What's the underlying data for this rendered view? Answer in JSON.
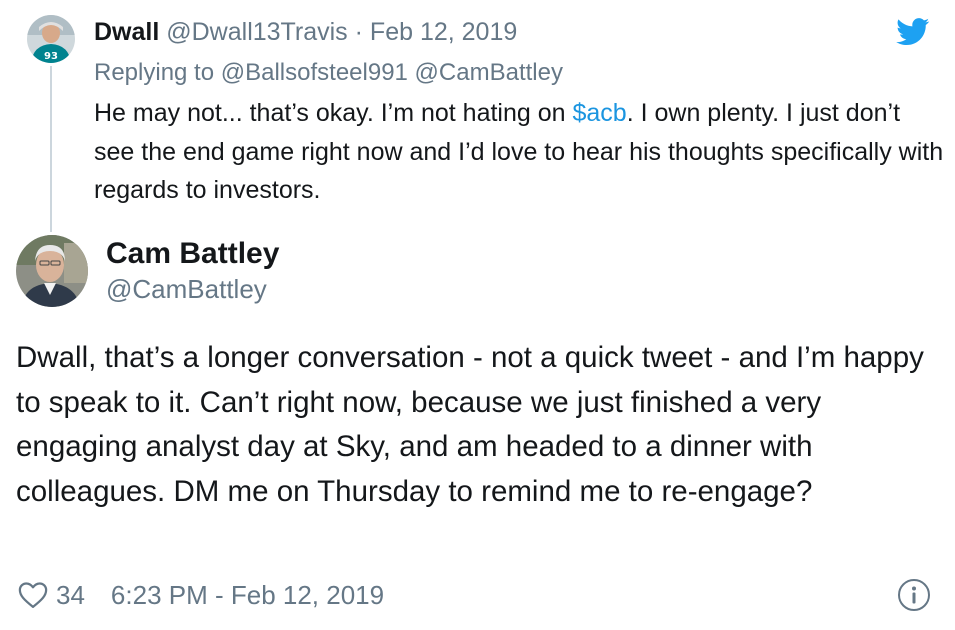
{
  "reply_tweet": {
    "author_name": "Dwall",
    "author_handle": "@Dwall13Travis",
    "separator": "·",
    "date": "Feb 12, 2019",
    "avatar_icon": "avatar-dwall-icon",
    "replying_prefix": "Replying to ",
    "replying_to": "@Ballsofsteel991 @CamBattley",
    "text_before_cashtag": "He may not... that’s okay. I’m not hating on ",
    "cashtag": "$acb",
    "text_after_cashtag": ". I own plenty. I just don’t see the end game right now and I’d love to hear his thoughts specifically with regards to investors."
  },
  "main_tweet": {
    "author_name": "Cam Battley",
    "author_handle": "@CamBattley",
    "avatar_icon": "avatar-cam-battley-icon",
    "text": "Dwall, that’s a longer conversation - not a quick tweet - and I’m happy to speak to it. Can’t right now, because we just finished a very engaging analyst day at Sky, and am headed to a dinner with colleagues. DM me on Thursday to remind me to re-engage?",
    "like_count": "34",
    "timestamp": "6:23 PM - Feb 12, 2019"
  },
  "icons": {
    "brand": "twitter-bird-icon",
    "like": "heart-icon",
    "info": "info-icon"
  },
  "colors": {
    "twitter_blue": "#1da1f2",
    "link_blue": "#1b95e0",
    "secondary_text": "#657786",
    "primary_text": "#14171a",
    "thread_line": "#ccd6dd"
  }
}
